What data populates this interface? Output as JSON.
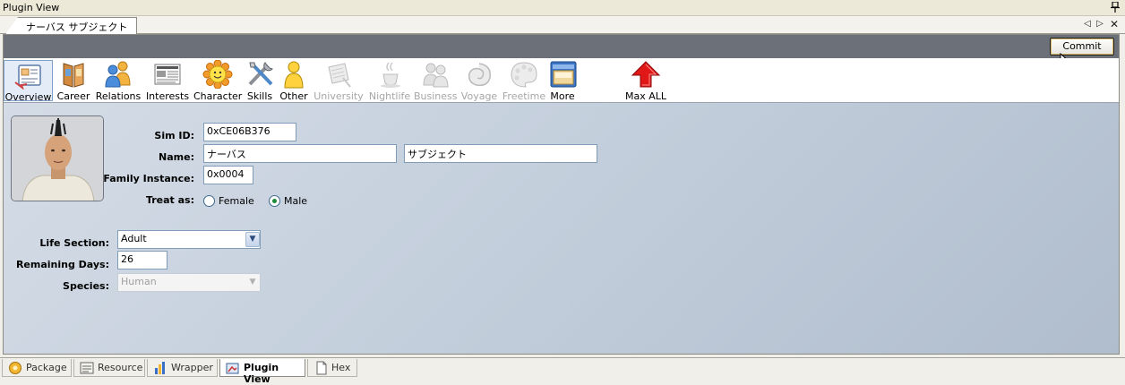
{
  "window": {
    "title": "Plugin View"
  },
  "doc_tab": {
    "label": "ナーバス サブジェクト"
  },
  "commit": {
    "label": "Commit"
  },
  "toolbar": {
    "items": [
      {
        "label": "Overview",
        "icon": "overview-icon",
        "enabled": true,
        "selected": true
      },
      {
        "label": "Career",
        "icon": "career-icon",
        "enabled": true
      },
      {
        "label": "Relations",
        "icon": "relations-icon",
        "enabled": true
      },
      {
        "label": "Interests",
        "icon": "interests-icon",
        "enabled": true
      },
      {
        "label": "Character",
        "icon": "character-icon",
        "enabled": true
      },
      {
        "label": "Skills",
        "icon": "skills-icon",
        "enabled": true
      },
      {
        "label": "Other",
        "icon": "other-icon",
        "enabled": true
      },
      {
        "label": "University",
        "icon": "university-icon",
        "enabled": false
      },
      {
        "label": "Nightlife",
        "icon": "nightlife-icon",
        "enabled": false
      },
      {
        "label": "Business",
        "icon": "business-icon",
        "enabled": false
      },
      {
        "label": "Voyage",
        "icon": "voyage-icon",
        "enabled": false
      },
      {
        "label": "Freetime",
        "icon": "freetime-icon",
        "enabled": false
      },
      {
        "label": "More",
        "icon": "more-icon",
        "enabled": true
      },
      {
        "label": "Max ALL",
        "icon": "max-all-icon",
        "enabled": true
      }
    ]
  },
  "form": {
    "sim_id": {
      "label": "Sim ID:",
      "value": "0xCE06B376"
    },
    "name": {
      "label": "Name:",
      "first": "ナーバス",
      "last": "サブジェクト"
    },
    "family_instance": {
      "label": "Family Instance:",
      "value": "0x0004"
    },
    "treat_as": {
      "label": "Treat as:",
      "options": [
        "Female",
        "Male"
      ],
      "selected": "Male"
    },
    "life_section": {
      "label": "Life Section:",
      "value": "Adult"
    },
    "remaining_days": {
      "label": "Remaining Days:",
      "value": "26"
    },
    "species": {
      "label": "Species:",
      "value": "Human",
      "enabled": false
    }
  },
  "bottom_tabs": [
    {
      "label": "Package",
      "icon": "package-icon"
    },
    {
      "label": "Resource",
      "icon": "resource-icon"
    },
    {
      "label": "Wrapper",
      "icon": "wrapper-icon"
    },
    {
      "label": "Plugin View",
      "icon": "plugin-view-icon",
      "active": true
    },
    {
      "label": "Hex",
      "icon": "hex-icon"
    }
  ],
  "colors": {
    "command_bar": "#6b7079",
    "panel_gradient_start": "#d6dde7",
    "panel_gradient_end": "#b0bdcd",
    "max_all_arrow": "#e01818"
  }
}
